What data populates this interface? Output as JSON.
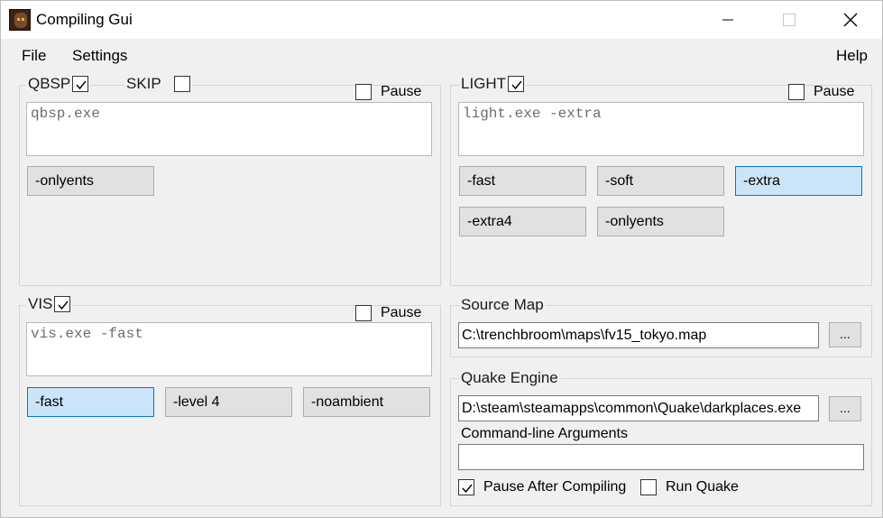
{
  "window": {
    "title": "Compiling Gui"
  },
  "menu": {
    "file": "File",
    "settings": "Settings",
    "help": "Help"
  },
  "qbsp": {
    "label": "QBSP",
    "checked": true,
    "skip_label": "SKIP",
    "skip_checked": false,
    "pause_label": "Pause",
    "pause_checked": false,
    "command": "qbsp.exe",
    "buttons": [
      {
        "label": "-onlyents",
        "selected": false
      }
    ]
  },
  "light": {
    "label": "LIGHT",
    "checked": true,
    "pause_label": "Pause",
    "pause_checked": false,
    "command": "light.exe -extra",
    "buttons": [
      {
        "label": "-fast",
        "selected": false
      },
      {
        "label": "-soft",
        "selected": false
      },
      {
        "label": "-extra",
        "selected": true
      },
      {
        "label": "-extra4",
        "selected": false
      },
      {
        "label": "-onlyents",
        "selected": false
      }
    ]
  },
  "vis": {
    "label": "VIS",
    "checked": true,
    "pause_label": "Pause",
    "pause_checked": false,
    "command": "vis.exe -fast",
    "buttons": [
      {
        "label": "-fast",
        "selected": true
      },
      {
        "label": "-level 4",
        "selected": false
      },
      {
        "label": "-noambient",
        "selected": false
      }
    ]
  },
  "source_map": {
    "label": "Source Map",
    "value": "C:\\trenchbroom\\maps\\fv15_tokyo.map",
    "browse_label": "..."
  },
  "quake_engine": {
    "label": "Quake Engine",
    "value": "D:\\steam\\steamapps\\common\\Quake\\darkplaces.exe",
    "browse_label": "...",
    "args_label": "Command-line Arguments",
    "args_value": "",
    "pause_after_label": "Pause After Compiling",
    "pause_after_checked": true,
    "run_quake_label": "Run Quake",
    "run_quake_checked": false
  },
  "colors": {
    "accent": "#0078d7",
    "selected_fill": "#cce4f7",
    "button_fill": "#e1e1e1",
    "panel": "#f0f0f0"
  }
}
